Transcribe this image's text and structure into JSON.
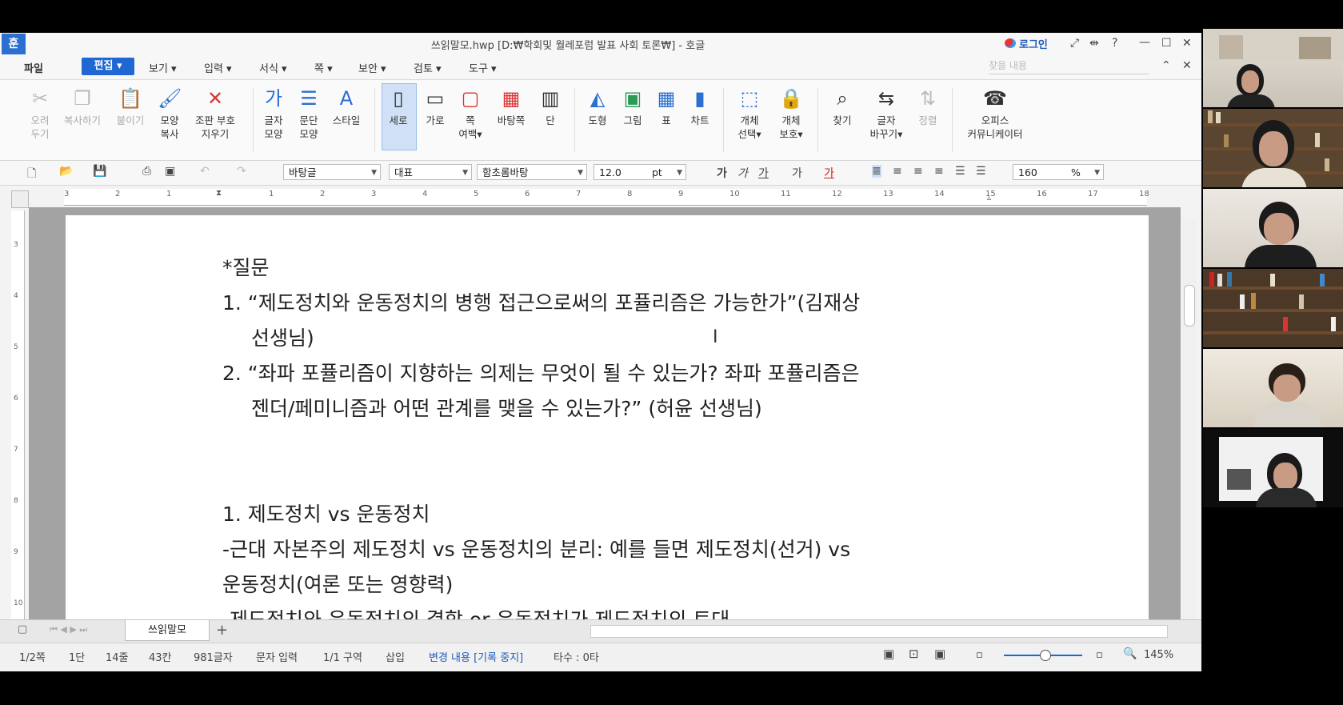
{
  "window": {
    "app_logo": "훈",
    "title": "쓰읽말모.hwp [D:₩학회및 월레포럼 발표 사회 토론₩] - 호글",
    "login": "로그인",
    "controls": [
      "⤢",
      "⇹",
      "?",
      "—",
      "☐",
      "✕"
    ]
  },
  "menubar": {
    "items": [
      "파일",
      "편집 ▾",
      "보기 ▾",
      "입력 ▾",
      "서식 ▾",
      "쪽 ▾",
      "보안 ▾",
      "검토 ▾",
      "도구 ▾"
    ],
    "find_placeholder": "찾을 내용"
  },
  "ribbon": {
    "cut": [
      "오려",
      "두기"
    ],
    "copy": "복사하기",
    "paste": "붙이기",
    "shape_copy": [
      "모양",
      "복사"
    ],
    "erase_mark": [
      "조판 부호",
      "지우기"
    ],
    "char_shape": [
      "글자",
      "모양"
    ],
    "para_shape": [
      "문단",
      "모양"
    ],
    "style": "스타일",
    "vertical": "세로",
    "horizontal": "가로",
    "page_margin": [
      "쪽",
      "여백▾"
    ],
    "background_page": "바탕쪽",
    "column": "단",
    "shape": "도형",
    "picture": "그림",
    "table": "표",
    "chart": "차트",
    "select_obj": [
      "개체",
      "선택▾"
    ],
    "protect_obj": [
      "개체",
      "보호▾"
    ],
    "find": "찾기",
    "replace": [
      "글자",
      "바꾸기▾"
    ],
    "sort": "정렬",
    "office_comm": [
      "오피스",
      "커뮤니케이터"
    ]
  },
  "formatbar": {
    "style_value": "바탕글",
    "language_value": "대표",
    "font_value": "함초롬바탕",
    "size_value": "12.0",
    "size_unit": "pt",
    "zoom_value": "160",
    "zoom_unit": "%"
  },
  "ruler": [
    "3",
    "2",
    "1",
    "1",
    "2",
    "3",
    "4",
    "5",
    "6",
    "7",
    "8",
    "9",
    "10",
    "11",
    "12",
    "13",
    "14",
    "15",
    "16",
    "17",
    "18"
  ],
  "vruler": [
    "3",
    "4",
    "5",
    "6",
    "7",
    "8",
    "9",
    "10"
  ],
  "document": {
    "lines": [
      "*질문",
      "1. “제도정치와 운동정치의 병행 접근으로써의 포퓰리즘은 가능한가”(김재상",
      "선생님)",
      "2. “좌파 포퓰리즘이 지향하는 의제는 무엇이 될 수 있는가? 좌파 포퓰리즘은",
      "젠더/페미니즘과 어떤 관계를 맺을 수 있는가?” (허윤 선생님)",
      "1. 제도정치 vs 운동정치",
      "-근대 자본주의 제도정치 vs 운동정치의 분리: 예를 들면 제도정치(선거) vs",
      "운동정치(여론 또는 영향력)",
      "-제도정치와 운동정치의 결합 or 운동정치가 제도정치의 토대"
    ]
  },
  "tabs": {
    "doc_tab": "쓰읽말모",
    "add": "+"
  },
  "status": {
    "page": "1/2쪽",
    "column": "1단",
    "line": "14줄",
    "col": "43칸",
    "chars": "981글자",
    "mode": "문자 입력",
    "section": "1/1 구역",
    "insert": "삽입",
    "track": "변경 내용 [기록 중지]",
    "typing": "타수 : 0타",
    "zoom": "145%"
  },
  "colors": {
    "accent": "#1f67d2",
    "underline": "#e89a3c",
    "status_link": "#1e5bb8"
  }
}
